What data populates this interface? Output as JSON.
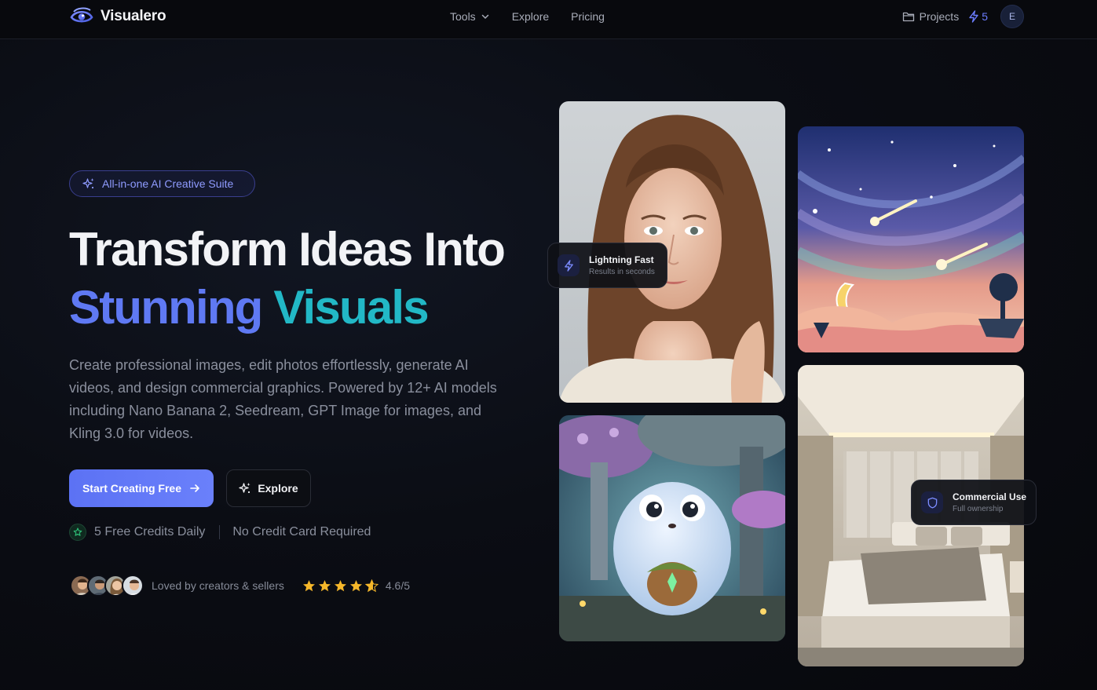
{
  "nav": {
    "brand": "Visualero",
    "links": [
      {
        "label": "Tools",
        "has_dropdown": true
      },
      {
        "label": "Explore"
      },
      {
        "label": "Pricing"
      }
    ],
    "projects_label": "Projects",
    "credits_count": "5",
    "avatar_initial": "E"
  },
  "hero": {
    "badge": "All-in-one AI Creative Suite",
    "title_line1": "Transform Ideas Into",
    "title_word1": "Stunning",
    "title_word2": "Visuals",
    "description": "Create professional images, edit photos effortlessly, generate AI videos, and design commercial graphics. Powered by 12+ AI models including Nano Banana 2, Seedream, GPT Image for images, and Kling 3.0 for videos.",
    "primary_cta": "Start Creating Free",
    "secondary_cta": "Explore",
    "perk1": "5 Free Credits Daily",
    "perk2": "No Credit Card Required",
    "social_text": "Loved by creators & sellers",
    "rating_value": 4.6,
    "rating_text": "4.6/5"
  },
  "gallery": {
    "pill1_title": "Lightning Fast",
    "pill1_sub": "Results in seconds",
    "pill2_title": "Commercial Use",
    "pill2_sub": "Full ownership"
  },
  "colors": {
    "accent": "#6a80fb",
    "title_blue": "#5f79f3",
    "title_teal": "#22b8c6",
    "star": "#f5b72a",
    "green": "#2fc47a"
  }
}
